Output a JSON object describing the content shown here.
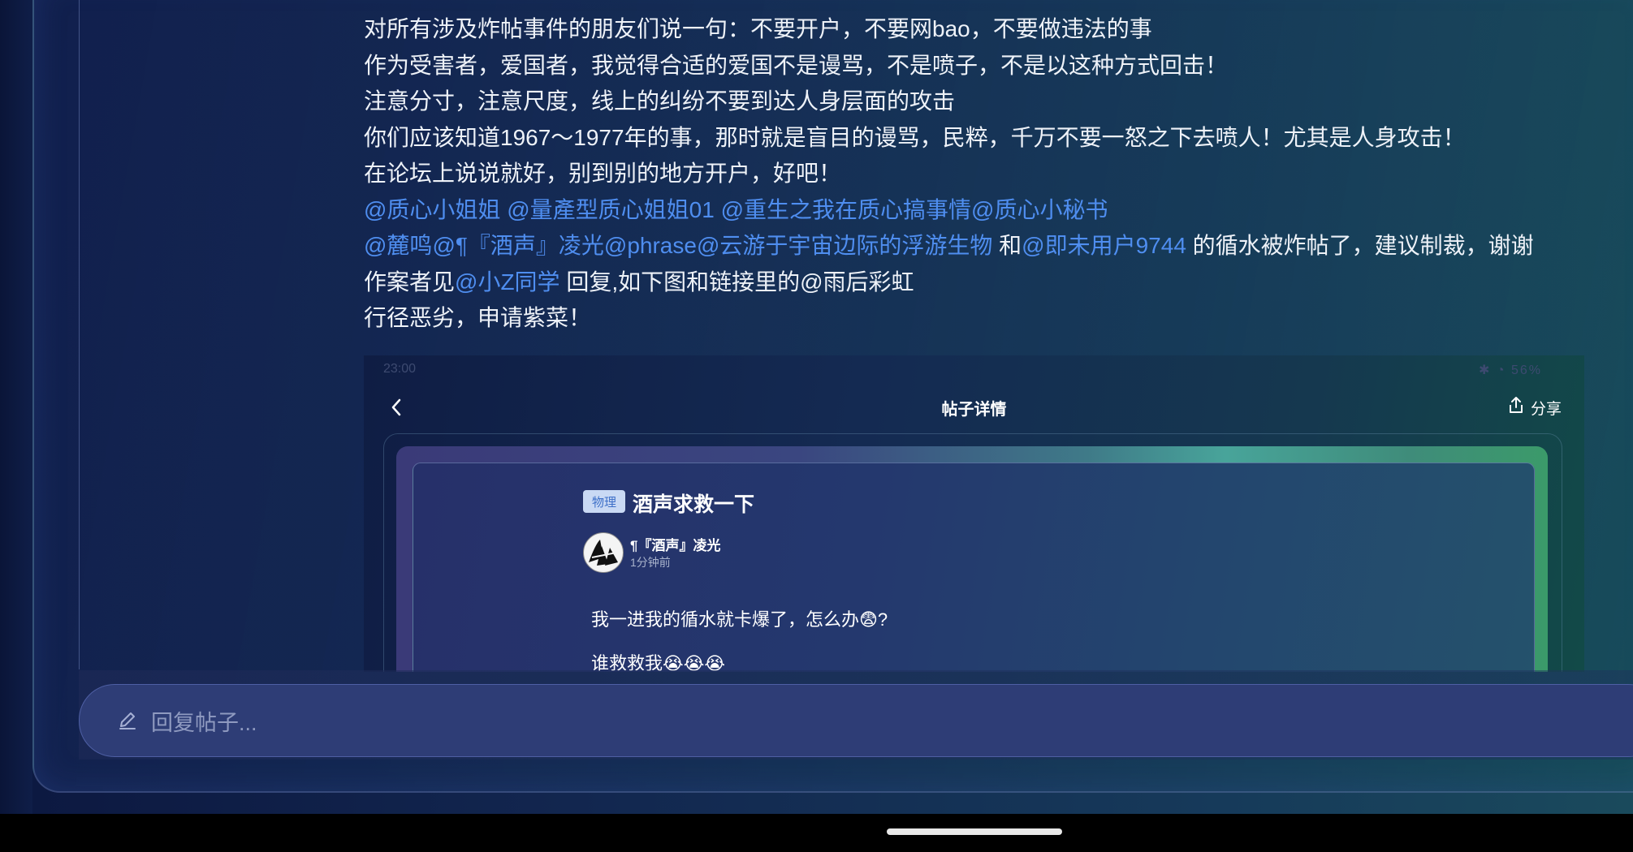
{
  "post": {
    "lines": [
      {
        "text": "对所有涉及炸帖事件的朋友们说一句：不要开户，不要网bao，不要做违法的事"
      },
      {
        "text": "作为受害者，爱国者，我觉得合适的爱国不是谩骂，不是喷子，不是以这种方式回击！"
      },
      {
        "text": "注意分寸，注意尺度，线上的纠纷不要到达人身层面的攻击"
      },
      {
        "text": "你们应该知道1967～1977年的事，那时就是盲目的谩骂，民粹，千万不要一怒之下去喷人！尤其是人身攻击！"
      },
      {
        "text": "在论坛上说说就好，别到别的地方开户，好吧！"
      }
    ],
    "mentions_line1": [
      "@质心小姐姐",
      "@量產型质心姐姐01",
      "@重生之我在质心搞事情",
      "@质心小秘书"
    ],
    "line7": {
      "mention1": "@麓鸣",
      "mention2": "@¶『酒声』凌光",
      "mention3": "@phrase",
      "mention4": "@云游于宇宙边际的浮游生物",
      "and": " 和",
      "mention5": "@即未用户9744",
      "rest": " 的循水被炸帖了，建议制裁，谢谢"
    },
    "line8": {
      "prefix": "作案者见",
      "mention": "@小Z同学",
      "rest": " 回复,如下图和链接里的@雨后彩虹"
    },
    "line9": "行径恶劣，申请紫菜！"
  },
  "embedded": {
    "status_time": "23:00",
    "status_right": "✱ ◔ 56%",
    "page_title": "帖子详情",
    "share_label": "分享",
    "tag": "物理",
    "post_title": "酒声求救一下",
    "username": "¶『酒声』凌光",
    "time_ago": "1分钟前",
    "body_line1": "我一进我的循水就卡爆了，怎么办😨?",
    "body_line2": "谁救救我😭😭😭"
  },
  "reply": {
    "placeholder": "回复帖子..."
  },
  "icons": [
    "back-chevron-icon",
    "share-icon",
    "pencil-icon"
  ],
  "colors": {
    "mention": "#4f8ef0",
    "tag_bg": "#c9d9f4",
    "reply_bar": "#2e3d76"
  }
}
